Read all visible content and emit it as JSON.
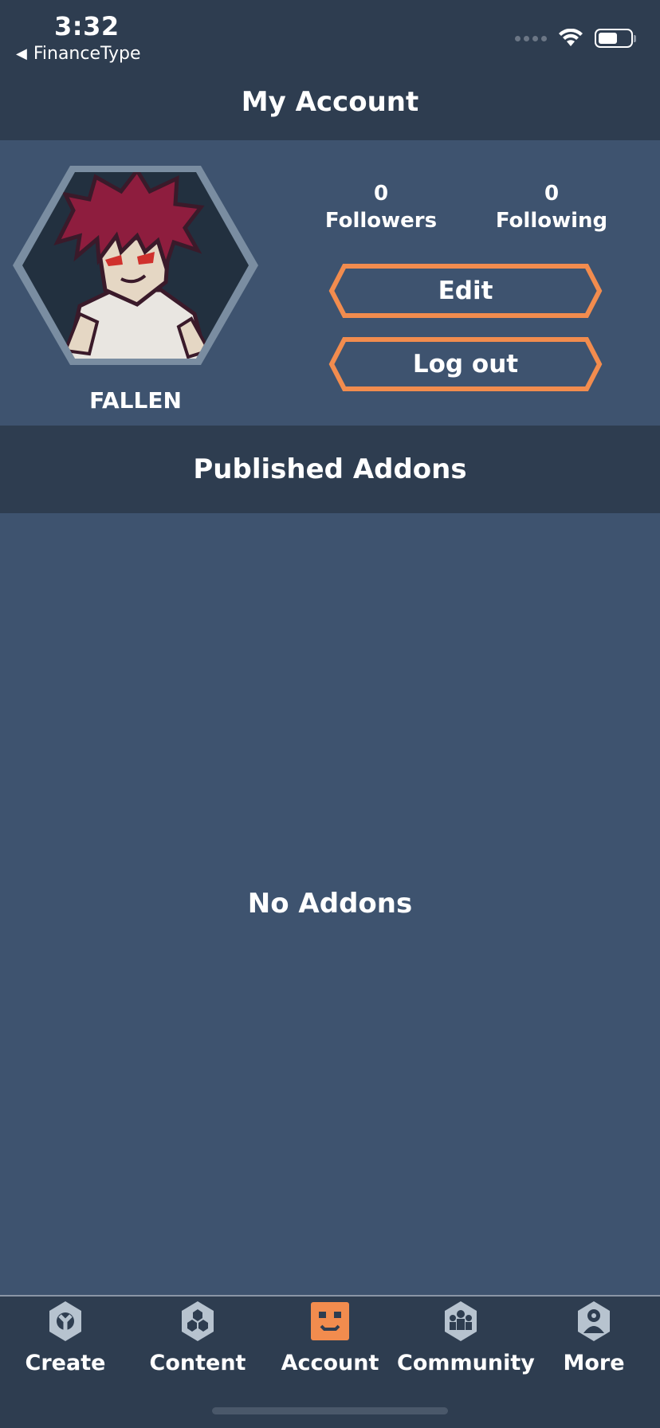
{
  "status_bar": {
    "time": "3:32",
    "back_app": "FinanceType"
  },
  "header": {
    "title": "My Account"
  },
  "profile": {
    "username": "FALLEN",
    "followers_count": "0",
    "followers_label": "Followers",
    "following_count": "0",
    "following_label": "Following",
    "edit_label": "Edit",
    "logout_label": "Log out"
  },
  "addons": {
    "section_title": "Published Addons",
    "empty_message": "No Addons"
  },
  "tabbar": {
    "items": [
      {
        "label": "Create",
        "icon": "wrench-gear-icon",
        "active": false
      },
      {
        "label": "Content",
        "icon": "hex-cluster-gear-icon",
        "active": false
      },
      {
        "label": "Account",
        "icon": "face-icon",
        "active": true
      },
      {
        "label": "Community",
        "icon": "people-gear-icon",
        "active": false
      },
      {
        "label": "More",
        "icon": "user-gear-icon",
        "active": false
      }
    ]
  },
  "colors": {
    "header_bg": "#2e3d50",
    "body_bg": "#3e536f",
    "accent": "#f28c4e",
    "icon_inactive": "#b7c3cf",
    "hex_border": "#7a8da1"
  }
}
